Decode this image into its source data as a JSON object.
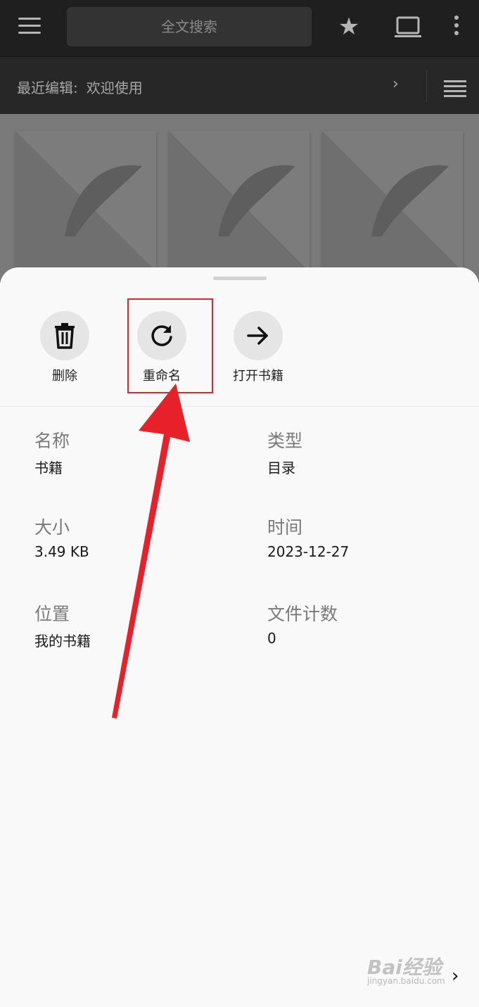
{
  "topbar": {
    "search_placeholder": "全文搜索",
    "icons": [
      "menu-icon",
      "star-icon",
      "laptop-icon",
      "more-vert-icon"
    ]
  },
  "recent": {
    "label": "最近编辑:",
    "value": "欢迎使用",
    "chevron": "›"
  },
  "sheet": {
    "actions": [
      {
        "label": "删除",
        "icon": "trash-icon"
      },
      {
        "label": "重命名",
        "icon": "refresh-icon"
      },
      {
        "label": "打开书籍",
        "icon": "arrow-right-icon"
      }
    ],
    "details": {
      "name_key": "名称",
      "name_val": "书籍",
      "type_key": "类型",
      "type_val": "目录",
      "size_key": "大小",
      "size_val": "3.49 KB",
      "time_key": "时间",
      "time_val": "2023-12-27",
      "loc_key": "位置",
      "loc_val": "我的书籍",
      "count_key": "文件计数",
      "count_val": "0"
    }
  },
  "annotation": {
    "highlight_color": "#e0262c",
    "arrow_color": "#e8202a"
  },
  "watermark": {
    "main": "Bai经验",
    "sub": "jingyan.baidu.com",
    "chevron": "›"
  }
}
